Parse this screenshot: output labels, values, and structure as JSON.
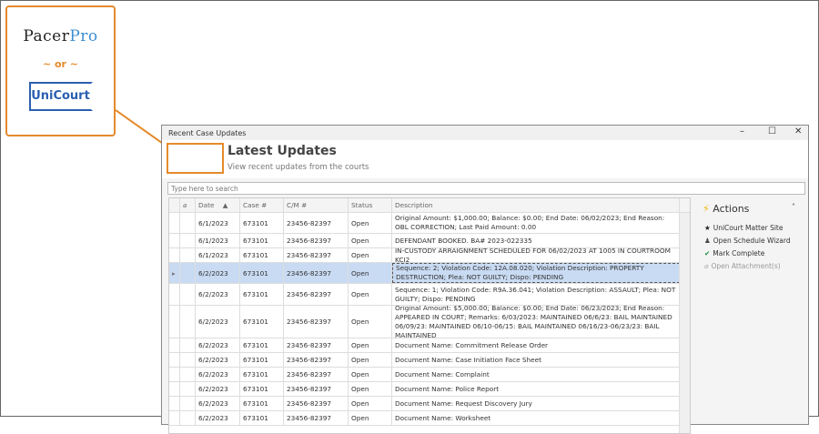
{
  "callout": {
    "logo1a": "Pacer",
    "logo1b": "Pro",
    "or": "~ or ~",
    "logo2": "UniCourt"
  },
  "window": {
    "title": "Recent Case Updates",
    "minimize": "–",
    "maximize": "☐",
    "close": "✕"
  },
  "header": {
    "title": "Latest Updates",
    "subtitle": "View recent updates from the courts"
  },
  "search": {
    "placeholder": "Type here to search"
  },
  "grid": {
    "columns": [
      "",
      "",
      "Date",
      "Case #",
      "C/M #",
      "Status",
      "Description"
    ],
    "rows": [
      {
        "date": "6/1/2023",
        "case": "673101",
        "cm": "23456-82397",
        "status": "Open",
        "desc": "Original Amount: $1,000.00; Balance: $0.00; End Date: 06/02/2023; End Reason: OBL CORRECTION; Last Paid Amount: 0.00"
      },
      {
        "date": "6/1/2023",
        "case": "673101",
        "cm": "23456-82397",
        "status": "Open",
        "desc": "DEFENDANT BOOKED. BA# 2023-022335"
      },
      {
        "date": "6/1/2023",
        "case": "673101",
        "cm": "23456-82397",
        "status": "Open",
        "desc": "IN-CUSTODY ARRAIGNMENT SCHEDULED FOR 06/02/2023 AT 1005 IN COURTROOM KCJ2"
      },
      {
        "date": "6/2/2023",
        "case": "673101",
        "cm": "23456-82397",
        "status": "Open",
        "desc": "Sequence: 2; Violation Code: 12A.08.020; Violation Description: PROPERTY DESTRUCTION; Plea: NOT GUILTY; Dispo: PENDING",
        "selected": true
      },
      {
        "date": "6/2/2023",
        "case": "673101",
        "cm": "23456-82397",
        "status": "Open",
        "desc": "Sequence: 1; Violation Code: R9A.36.041; Violation Description: ASSAULT; Plea: NOT GUILTY; Dispo: PENDING"
      },
      {
        "date": "6/2/2023",
        "case": "673101",
        "cm": "23456-82397",
        "status": "Open",
        "desc": "Original Amount: $5,000.00; Balance: $0.00; End Date: 06/23/2023; End Reason: APPEARED IN COURT; Remarks: 6/03/2023: MAINTAINED 06/6/23: BAIL MAINTAINED 06/09/23: MAINTAINED 06/10-06/15: BAIL MAINTAINED 06/16/23-06/23/23: BAIL MAINTAINED"
      },
      {
        "date": "6/2/2023",
        "case": "673101",
        "cm": "23456-82397",
        "status": "Open",
        "desc": "Document Name: Commitment Release Order"
      },
      {
        "date": "6/2/2023",
        "case": "673101",
        "cm": "23456-82397",
        "status": "Open",
        "desc": "Document Name: Case Initiation Face Sheet"
      },
      {
        "date": "6/2/2023",
        "case": "673101",
        "cm": "23456-82397",
        "status": "Open",
        "desc": "Document Name: Complaint"
      },
      {
        "date": "6/2/2023",
        "case": "673101",
        "cm": "23456-82397",
        "status": "Open",
        "desc": "Document Name: Police Report"
      },
      {
        "date": "6/2/2023",
        "case": "673101",
        "cm": "23456-82397",
        "status": "Open",
        "desc": "Document Name: Request Discovery Jury"
      },
      {
        "date": "6/2/2023",
        "case": "673101",
        "cm": "23456-82397",
        "status": "Open",
        "desc": "Document Name: Worksheet"
      }
    ]
  },
  "actions": {
    "title": "Actions",
    "items": [
      {
        "label": "UniCourt Matter Site",
        "icon": "★",
        "color": "#222"
      },
      {
        "label": "Open Schedule Wizard",
        "icon": "♟",
        "color": "#444"
      },
      {
        "label": "Mark Complete",
        "icon": "✔",
        "color": "#1a8a3a"
      },
      {
        "label": "Open Attachment(s)",
        "icon": "⌀",
        "color": "#aaa"
      }
    ]
  }
}
